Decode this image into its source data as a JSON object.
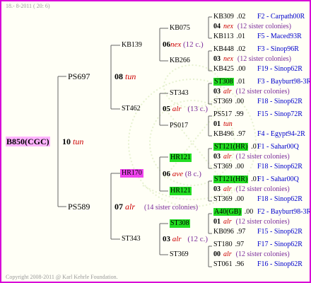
{
  "header": {
    "date": "18.- 8-2011 ( 20: 6)"
  },
  "footer": {
    "copyright": "Copyright 2008-2011 @ Karl Kehrle Foundation."
  },
  "root": {
    "id": "B850(CGC)",
    "gen": "10",
    "type": "tun"
  },
  "gen1": [
    {
      "id": "PS697"
    },
    {
      "id": "PS589"
    }
  ],
  "gen2": [
    {
      "id": "KB139"
    },
    {
      "id": "ST462"
    },
    {
      "id": "HR170"
    },
    {
      "id": "ST343"
    }
  ],
  "gen2_labels": [
    {
      "num": "08",
      "type": "tun"
    },
    {
      "num": "07",
      "type": "alr",
      "note": "(14 sister colonies)"
    }
  ],
  "gen3": [
    {
      "id": "KB075"
    },
    {
      "id": "KB266"
    },
    {
      "id": "ST343"
    },
    {
      "id": "PS017"
    },
    {
      "id": "HR121"
    },
    {
      "id": "HR121"
    },
    {
      "id": "ST308"
    },
    {
      "id": "ST369"
    }
  ],
  "gen3_labels": [
    {
      "num": "06",
      "type": "nex",
      "note": "(12 c.)"
    },
    {
      "num": "05",
      "type": "alr",
      "note": "(13 c.)"
    },
    {
      "num": "06",
      "type": "ave",
      "note": "(8 c.)"
    },
    {
      "num": "03",
      "type": "alr",
      "note": "(12 c.)"
    }
  ],
  "gen4": [
    {
      "id": "KB309",
      "yr": ".02",
      "code": "F2 - Carpath00R"
    },
    {
      "num": "04",
      "type": "nex",
      "note": "(12 sister colonies)"
    },
    {
      "id": "KB113",
      "yr": ".01",
      "code": "F5 - Maced93R"
    },
    {
      "id": "KB448",
      "yr": ".02",
      "code": "F3 - Sinop96R"
    },
    {
      "num": "03",
      "type": "nex",
      "note": "(12 sister colonies)"
    },
    {
      "id": "KB425",
      "yr": ".00",
      "code": "F19 - Sinop62R"
    },
    {
      "id": "ST308",
      "yr": ".01",
      "code": "F3 - Bayburt98-3R"
    },
    {
      "num": "03",
      "type": "alr",
      "note": "(12 sister colonies)"
    },
    {
      "id": "ST369",
      "yr": ".00",
      "code": "F18 - Sinop62R"
    },
    {
      "id": "PS517",
      "yr": ".99",
      "code": "F15 - Sinop72R"
    },
    {
      "num": "01",
      "type": "tun",
      "note": ""
    },
    {
      "id": "KB496",
      "yr": ".97",
      "code": "F4 - Egypt94-2R"
    },
    {
      "id": "ST121(HR)",
      "yr": ".01",
      "code": "F1 - Sahar00Q"
    },
    {
      "num": "03",
      "type": "alr",
      "note": "(12 sister colonies)"
    },
    {
      "id": "ST369",
      "yr": ".00",
      "code": "F18 - Sinop62R"
    },
    {
      "id": "ST121(HR)",
      "yr": ".01",
      "code": "F1 - Sahar00Q"
    },
    {
      "num": "03",
      "type": "alr",
      "note": "(12 sister colonies)"
    },
    {
      "id": "ST369",
      "yr": ".00",
      "code": "F18 - Sinop62R"
    },
    {
      "id": "A40(GB)",
      "yr": ".00",
      "code": "F2 - Bayburt98-3R"
    },
    {
      "num": "01",
      "type": "alr",
      "note": "(12 sister colonies)"
    },
    {
      "id": "KB096",
      "yr": ".97",
      "code": "F15 - Sinop62R"
    },
    {
      "id": "ST180",
      "yr": ".97",
      "code": "F17 - Sinop62R"
    },
    {
      "num": "00",
      "type": "alr",
      "note": "(12 sister colonies)"
    },
    {
      "id": "ST061",
      "yr": ".96",
      "code": "F16 - Sinop62R"
    }
  ],
  "colors": {
    "border": "#d800d8",
    "green_highlight": "#22dd22",
    "magenta_highlight": "#ee44ee",
    "line": "#666666"
  }
}
